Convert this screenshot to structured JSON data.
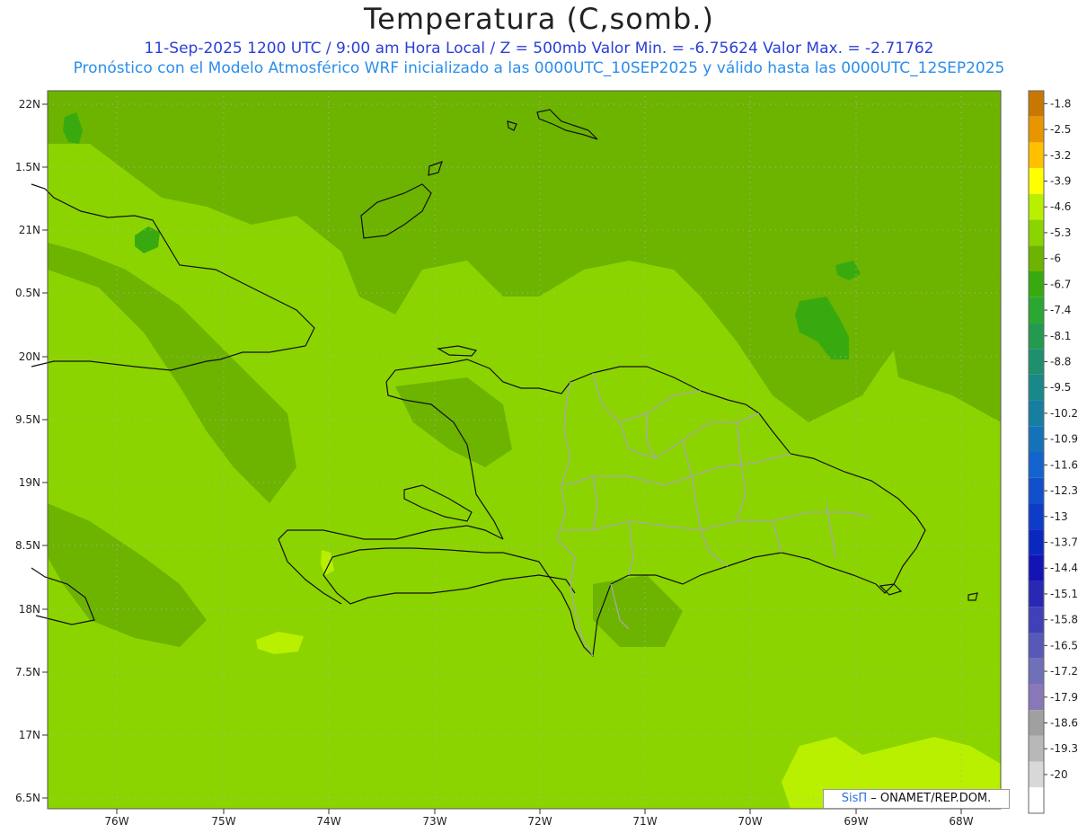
{
  "header": {
    "title": "Temperatura (C,somb.)",
    "line1": "11-Sep-2025  1200 UTC / 9:00 am Hora Local / Z = 500mb  Valor Min. = -6.75624  Valor Max. = -2.71762",
    "line2": "Pronóstico con el Modelo Atmosférico WRF inicializado a las 0000UTC_10SEP2025 y válido hasta las  0000UTC_12SEP2025"
  },
  "axes": {
    "lat_labels": [
      "22N",
      "1.5N",
      "21N",
      "0.5N",
      "20N",
      "9.5N",
      "19N",
      "8.5N",
      "18N",
      "7.5N",
      "17N",
      "6.5N"
    ],
    "lon_labels": [
      "76W",
      "75W",
      "74W",
      "73W",
      "72W",
      "71W",
      "70W",
      "69W",
      "68W"
    ]
  },
  "colorbar": {
    "levels": [
      {
        "label": "-1.8",
        "color": "#c87800"
      },
      {
        "label": "-2.5",
        "color": "#e89600"
      },
      {
        "label": "-3.2",
        "color": "#ffc000"
      },
      {
        "label": "-3.9",
        "color": "#ffff00"
      },
      {
        "label": "-4.6",
        "color": "#b8f000"
      },
      {
        "label": "-5.3",
        "color": "#8cd400"
      },
      {
        "label": "-6",
        "color": "#6cb400"
      },
      {
        "label": "-6.7",
        "color": "#38aa10"
      },
      {
        "label": "-7.4",
        "color": "#2aa832"
      },
      {
        "label": "-8.1",
        "color": "#249a50"
      },
      {
        "label": "-8.8",
        "color": "#1e906e"
      },
      {
        "label": "-9.5",
        "color": "#188888"
      },
      {
        "label": "-10.2",
        "color": "#167ea0"
      },
      {
        "label": "-10.9",
        "color": "#1472b8"
      },
      {
        "label": "-11.6",
        "color": "#1264cc"
      },
      {
        "label": "-12.3",
        "color": "#1050cc"
      },
      {
        "label": "-13",
        "color": "#0c3cc8"
      },
      {
        "label": "-13.7",
        "color": "#0a28c0"
      },
      {
        "label": "-14.4",
        "color": "#1414b4"
      },
      {
        "label": "-15.1",
        "color": "#2828b4"
      },
      {
        "label": "-15.8",
        "color": "#4040b8"
      },
      {
        "label": "-16.5",
        "color": "#5858b8"
      },
      {
        "label": "-17.2",
        "color": "#7070b8"
      },
      {
        "label": "-17.9",
        "color": "#8878b8"
      },
      {
        "label": "-18.6",
        "color": "#a0a0a0"
      },
      {
        "label": "-19.3",
        "color": "#b8b8b8"
      },
      {
        "label": "-20",
        "color": "#d8d8d8"
      },
      {
        "label": "",
        "color": "#ffffff"
      }
    ]
  },
  "field_colors": {
    "base": "#8cd400",
    "dark": "#6cb400",
    "darker": "#38aa10",
    "light": "#b8f000",
    "coast": "#111111",
    "provinces": "#a8a8a8"
  },
  "credit": {
    "sis": "SisΠ",
    "rest": "– ONAMET/REP.DOM."
  }
}
